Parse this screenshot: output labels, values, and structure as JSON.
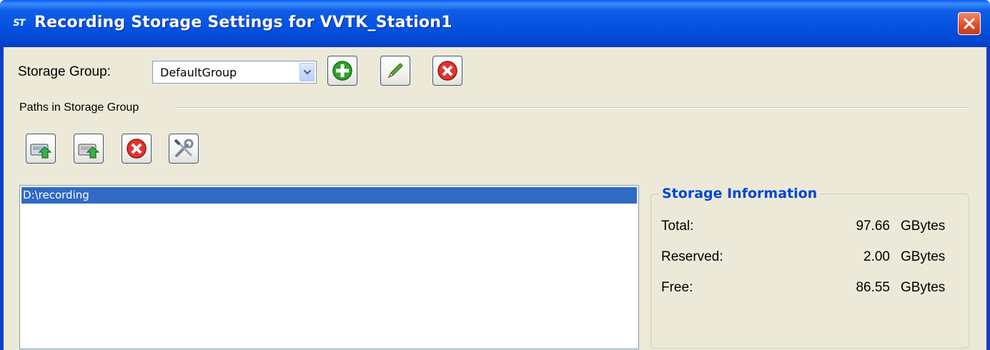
{
  "window": {
    "title": "Recording Storage Settings for VVTK_Station1",
    "app_icon_text": "ST",
    "titlebar_color": "#0553e0",
    "close_icon": "close-icon"
  },
  "storage_group": {
    "label": "Storage Group:",
    "selected": "DefaultGroup",
    "add_icon": "plus-icon",
    "edit_icon": "pencil-icon",
    "delete_icon": "delete-x-icon"
  },
  "paths": {
    "section_label": "Paths in Storage Group",
    "toolbar_icons": [
      "add-path-icon",
      "remove-path-icon",
      "delete-x-icon",
      "tools-icon"
    ],
    "items": [
      "D:\\recording"
    ],
    "selected_index": 0,
    "selection_color": "#316ac5"
  },
  "storage_info": {
    "title": "Storage Information",
    "title_color": "#0046d5",
    "rows": [
      {
        "label": "Total:",
        "value": "97.66",
        "unit": "GBytes"
      },
      {
        "label": "Reserved:",
        "value": "2.00",
        "unit": "GBytes"
      },
      {
        "label": "Free:",
        "value": "86.55",
        "unit": "GBytes"
      }
    ]
  }
}
